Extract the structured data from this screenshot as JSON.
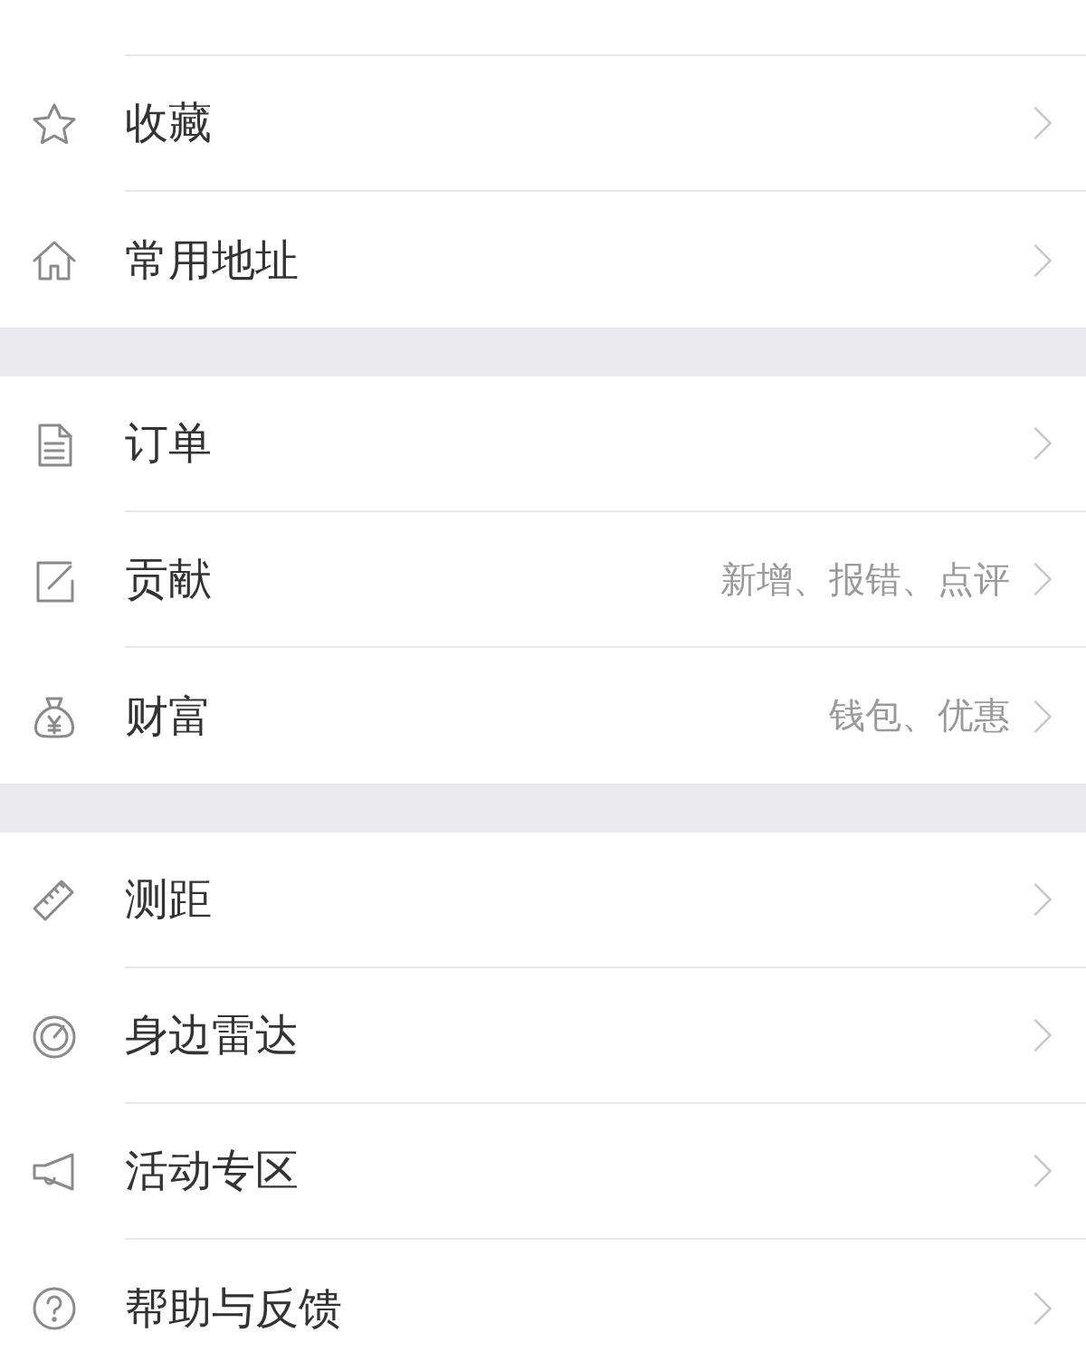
{
  "sections": [
    {
      "items": [
        {
          "label": "收藏"
        },
        {
          "label": "常用地址"
        }
      ]
    },
    {
      "items": [
        {
          "label": "订单"
        },
        {
          "label": "贡献",
          "detail": "新增、报错、点评"
        },
        {
          "label": "财富",
          "detail": "钱包、优惠"
        }
      ]
    },
    {
      "items": [
        {
          "label": "测距"
        },
        {
          "label": "身边雷达"
        },
        {
          "label": "活动专区"
        },
        {
          "label": "帮助与反馈"
        }
      ]
    }
  ]
}
